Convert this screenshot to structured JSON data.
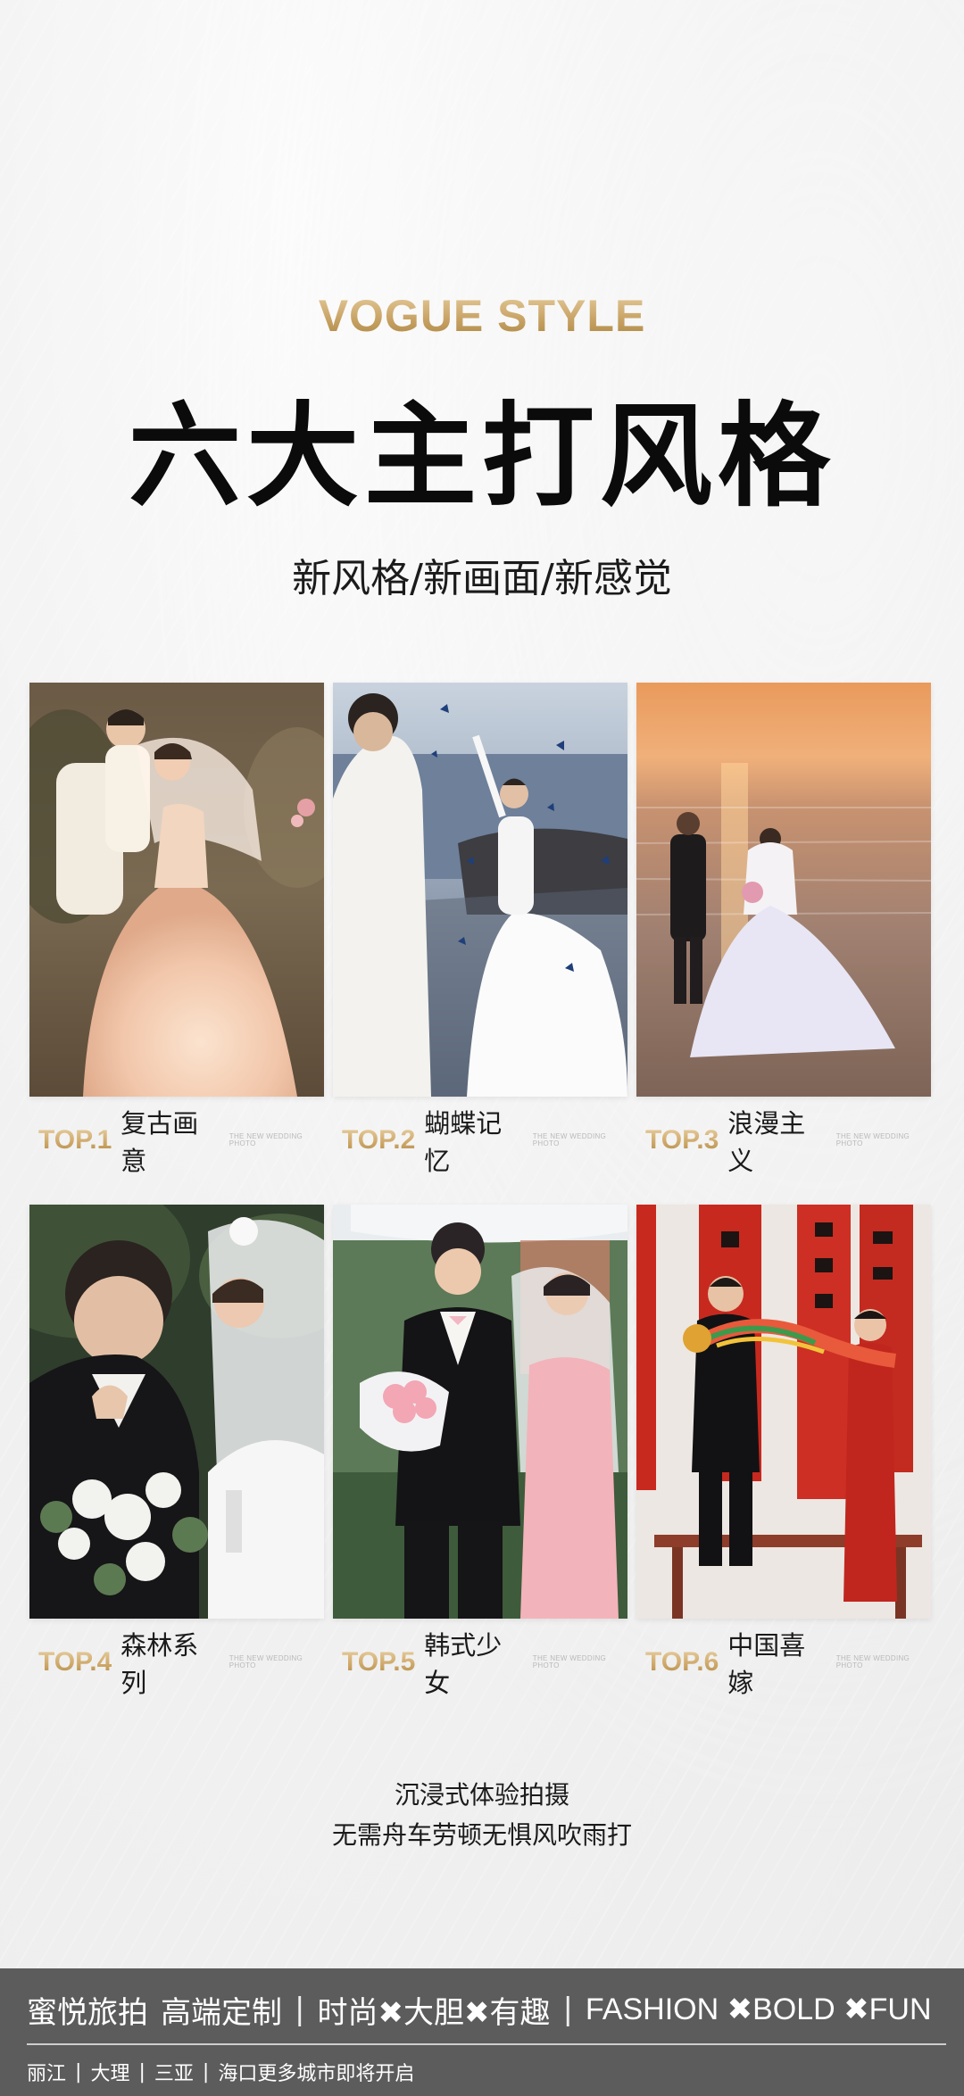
{
  "header": {
    "eyebrow": "VOGUE STYLE",
    "title": "六大主打风格",
    "subtitle": "新风格/新画面/新感觉"
  },
  "styles": [
    {
      "rank": "TOP.1",
      "name": "复古画意",
      "tag": "THE NEW WEDDING PHOTO",
      "photo": "retro-painterly-couple"
    },
    {
      "rank": "TOP.2",
      "name": "蝴蝶记忆",
      "tag": "THE NEW WEDDING PHOTO",
      "photo": "butterfly-seaside-couple"
    },
    {
      "rank": "TOP.3",
      "name": "浪漫主义",
      "tag": "THE NEW WEDDING PHOTO",
      "photo": "sunset-beach-couple"
    },
    {
      "rank": "TOP.4",
      "name": "森林系列",
      "tag": "THE NEW WEDDING PHOTO",
      "photo": "forest-garden-couple"
    },
    {
      "rank": "TOP.5",
      "name": "韩式少女",
      "tag": "THE NEW WEDDING PHOTO",
      "photo": "korean-style-couple"
    },
    {
      "rank": "TOP.6",
      "name": "中国喜嫁",
      "tag": "THE NEW WEDDING PHOTO",
      "photo": "chinese-red-wedding"
    }
  ],
  "caption": {
    "line1": "沉浸式体验拍摄",
    "line2": "无需舟车劳顿无惧风吹雨打"
  },
  "footer": {
    "brand": "蜜悦旅拍",
    "tagline": "高端定制",
    "divider": "|",
    "slogan": "时尚✖大胆✖有趣",
    "slogan_en": "FASHION ✖BOLD ✖FUN",
    "cities": [
      "丽江",
      "大理",
      "三亚",
      "海口更多城市即将开启"
    ]
  },
  "colors": {
    "gold": "#c9a466",
    "footer_bg": "#5c5c5c",
    "title": "#0b0b0b"
  }
}
